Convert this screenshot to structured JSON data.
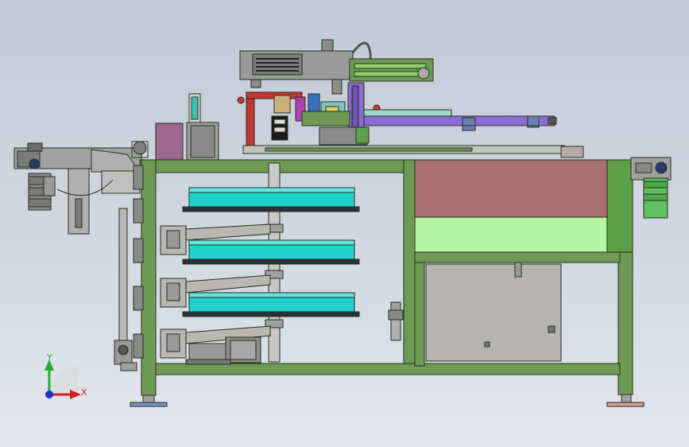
{
  "viewport": {
    "background_top": "#c3c9d6",
    "background_bottom": "#e4e7ed"
  },
  "colors": {
    "frame_green": "#6f9a55",
    "frame_outline": "#233019",
    "turntable_cyan": "#1fd3cc",
    "panel_brown": "#a87070",
    "panel_light_green": "#b4f5a3",
    "cabinet_grey": "#b6b4b1",
    "bracket_grey": "#b9b6b3",
    "motor_grey": "#9a9a9a",
    "conveyor_purple": "#8a6dd0",
    "motor_green": "#5fc060"
  },
  "axis_triad": {
    "x_label": "X",
    "y_label": "Y",
    "x_color": "#d02020",
    "y_color": "#20b030",
    "z_color": "#2030d0"
  }
}
